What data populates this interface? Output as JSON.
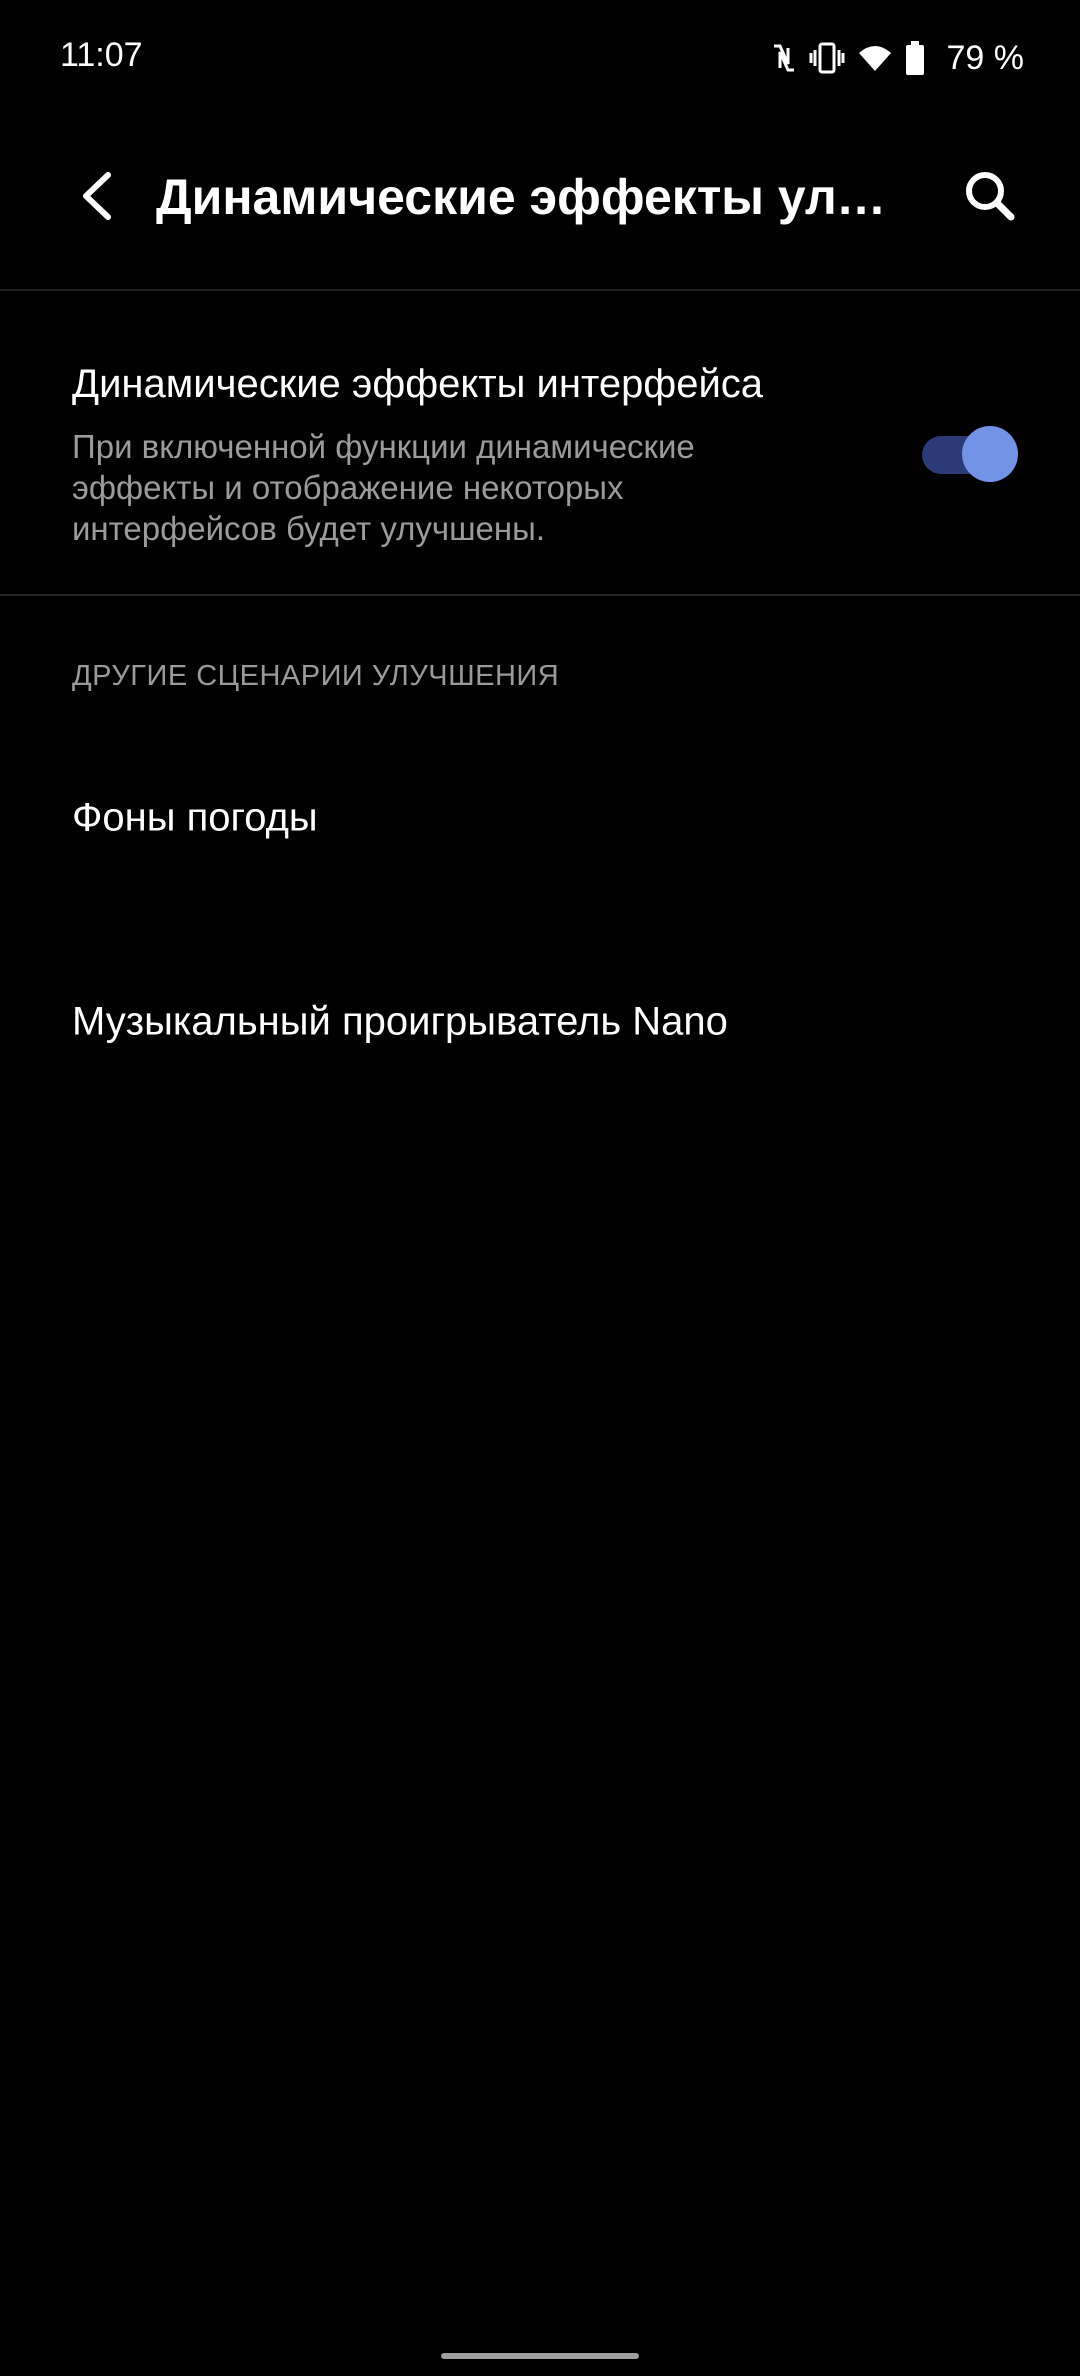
{
  "status_bar": {
    "time": "11:07",
    "battery_percent": "79 %",
    "icons": [
      "nfc-icon",
      "vibrate-icon",
      "wifi-icon",
      "battery-icon"
    ]
  },
  "app_bar": {
    "title": "Динамические эффекты улучшения",
    "back_icon": "chevron-left-icon",
    "search_icon": "search-icon"
  },
  "main_setting": {
    "title": "Динамические эффекты интерфейса",
    "summary": "При включенной функции динамические эффекты и отображение некоторых интерфейсов будет улучшены.",
    "enabled": true
  },
  "section": {
    "header": "ДРУГИЕ СЦЕНАРИИ УЛУЧШЕНИЯ",
    "items": [
      {
        "label": "Фоны погоды"
      },
      {
        "label": "Музыкальный проигрыватель Nano"
      }
    ]
  },
  "colors": {
    "background": "#000000",
    "toggle_track": "#2b3b78",
    "toggle_thumb": "#7393e6",
    "secondary_text": "#9b9b9b"
  }
}
